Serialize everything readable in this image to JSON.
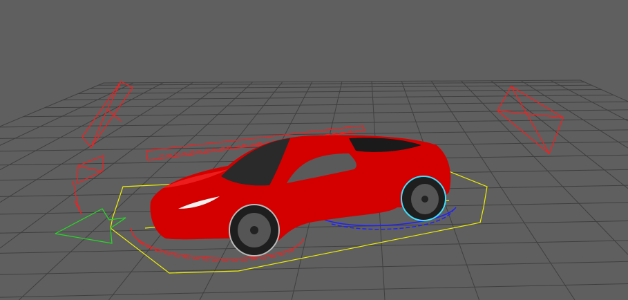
{
  "viewport": {
    "background_color": "#5f5f5f",
    "grid_color": "#3f3f3f",
    "car_color": "#d40000",
    "control_colors": {
      "red": "#ff1a1a",
      "yellow": "#f0f000",
      "green": "#22dd22",
      "blue": "#2020ff",
      "cyan": "#40e0ff"
    }
  }
}
